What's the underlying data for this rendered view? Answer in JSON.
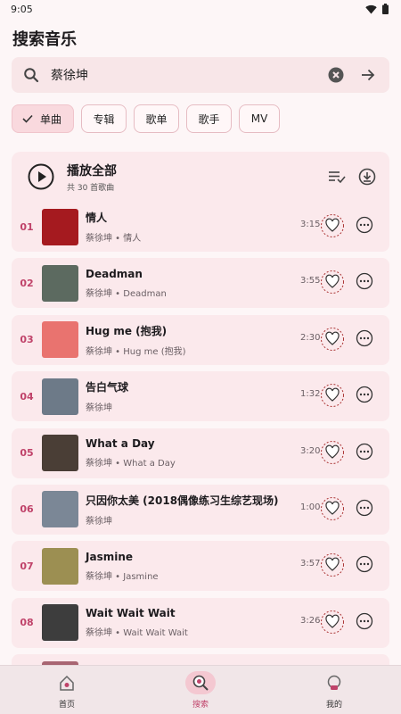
{
  "status": {
    "time": "9:05"
  },
  "page": {
    "title": "搜索音乐"
  },
  "search": {
    "value": "蔡徐坤",
    "placeholder": ""
  },
  "filters": [
    {
      "label": "单曲",
      "selected": true
    },
    {
      "label": "专辑",
      "selected": false
    },
    {
      "label": "歌单",
      "selected": false
    },
    {
      "label": "歌手",
      "selected": false
    },
    {
      "label": "MV",
      "selected": false
    }
  ],
  "playall": {
    "title": "播放全部",
    "subtitle": "共 30 首歌曲"
  },
  "songs": [
    {
      "index": "01",
      "title": "情人",
      "artist": "蔡徐坤",
      "album": "情人",
      "duration": "3:15",
      "cover_color": "#a51a1f"
    },
    {
      "index": "02",
      "title": "Deadman",
      "artist": "蔡徐坤",
      "album": "Deadman",
      "duration": "3:55",
      "cover_color": "#5c6a60"
    },
    {
      "index": "03",
      "title": "Hug me (抱我)",
      "artist": "蔡徐坤",
      "album": "Hug me (抱我)",
      "duration": "2:30",
      "cover_color": "#e9736f"
    },
    {
      "index": "04",
      "title": "告白气球",
      "artist": "蔡徐坤",
      "album": "",
      "duration": "1:32",
      "cover_color": "#6d7a88"
    },
    {
      "index": "05",
      "title": "What a Day",
      "artist": "蔡徐坤",
      "album": "What a Day",
      "duration": "3:20",
      "cover_color": "#4a3e36"
    },
    {
      "index": "06",
      "title": "只因你太美 (2018偶像练习生综艺现场)",
      "artist": "蔡徐坤",
      "album": "",
      "duration": "1:00",
      "cover_color": "#7b8796"
    },
    {
      "index": "07",
      "title": "Jasmine",
      "artist": "蔡徐坤",
      "album": "Jasmine",
      "duration": "3:57",
      "cover_color": "#9c8f52"
    },
    {
      "index": "08",
      "title": "Wait Wait Wait",
      "artist": "蔡徐坤",
      "album": "Wait Wait Wait",
      "duration": "3:26",
      "cover_color": "#3d3d3d"
    },
    {
      "index": "",
      "title": "",
      "artist": "",
      "album": "",
      "duration": "",
      "cover_color": "#a86572"
    }
  ],
  "nav": [
    {
      "label": "首页",
      "icon": "home-icon",
      "active": false
    },
    {
      "label": "搜索",
      "icon": "search-icon",
      "active": true
    },
    {
      "label": "我的",
      "icon": "profile-icon",
      "active": false
    }
  ],
  "colors": {
    "accent": "#c0436a",
    "chip_selected": "#f9d9de",
    "card": "#fbe9ec",
    "background": "#fdf6f7"
  }
}
